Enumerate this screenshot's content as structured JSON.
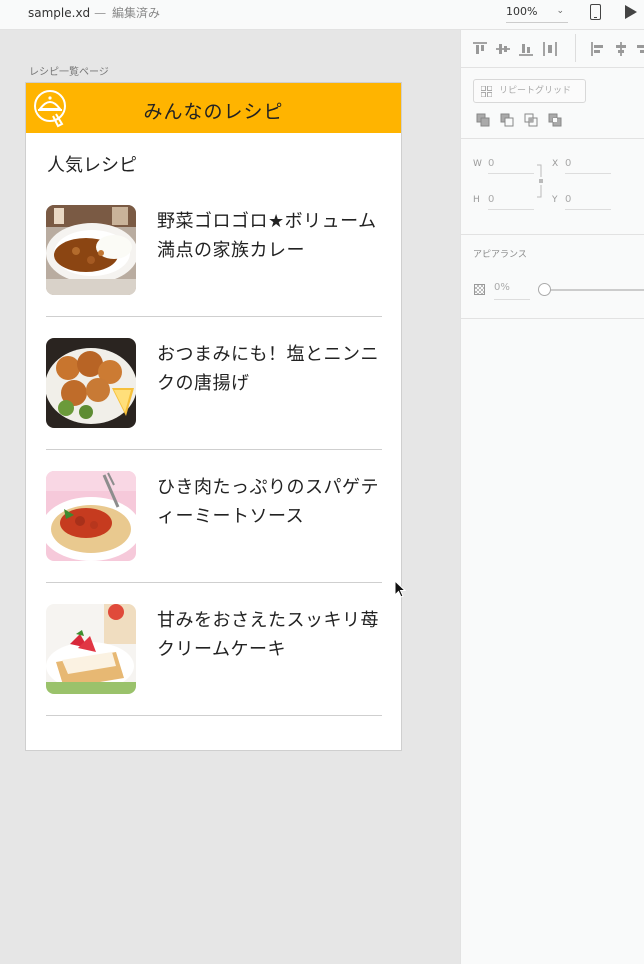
{
  "window": {
    "file_name": "sample.xd",
    "separator": "—",
    "status": "編集済み",
    "zoom": "100%"
  },
  "artboard": {
    "label": "レシピ一覧ページ",
    "app_title": "みんなのレシピ",
    "section_title": "人気レシピ",
    "recipes": [
      {
        "title": "野菜ゴロゴロ★ボリューム満点の家族カレー",
        "image": "curry-rice-photo"
      },
      {
        "title": "おつまみにも！塩とニンニクの唐揚げ",
        "image": "karaage-photo"
      },
      {
        "title": "ひき肉たっぷりのスパゲティーミートソース",
        "image": "spaghetti-photo"
      },
      {
        "title": "甘みをおさえたスッキリ苺クリームケーキ",
        "image": "strawberry-cake-photo"
      }
    ],
    "header_color": "#ffb400"
  },
  "panel": {
    "repeat_grid_label": "リピートグリッド",
    "w_label": "W",
    "w_value": "0",
    "h_label": "H",
    "h_value": "0",
    "x_label": "X",
    "x_value": "0",
    "y_label": "Y",
    "y_value": "0",
    "appearance_label": "アピアランス",
    "opacity_value": "0%"
  }
}
